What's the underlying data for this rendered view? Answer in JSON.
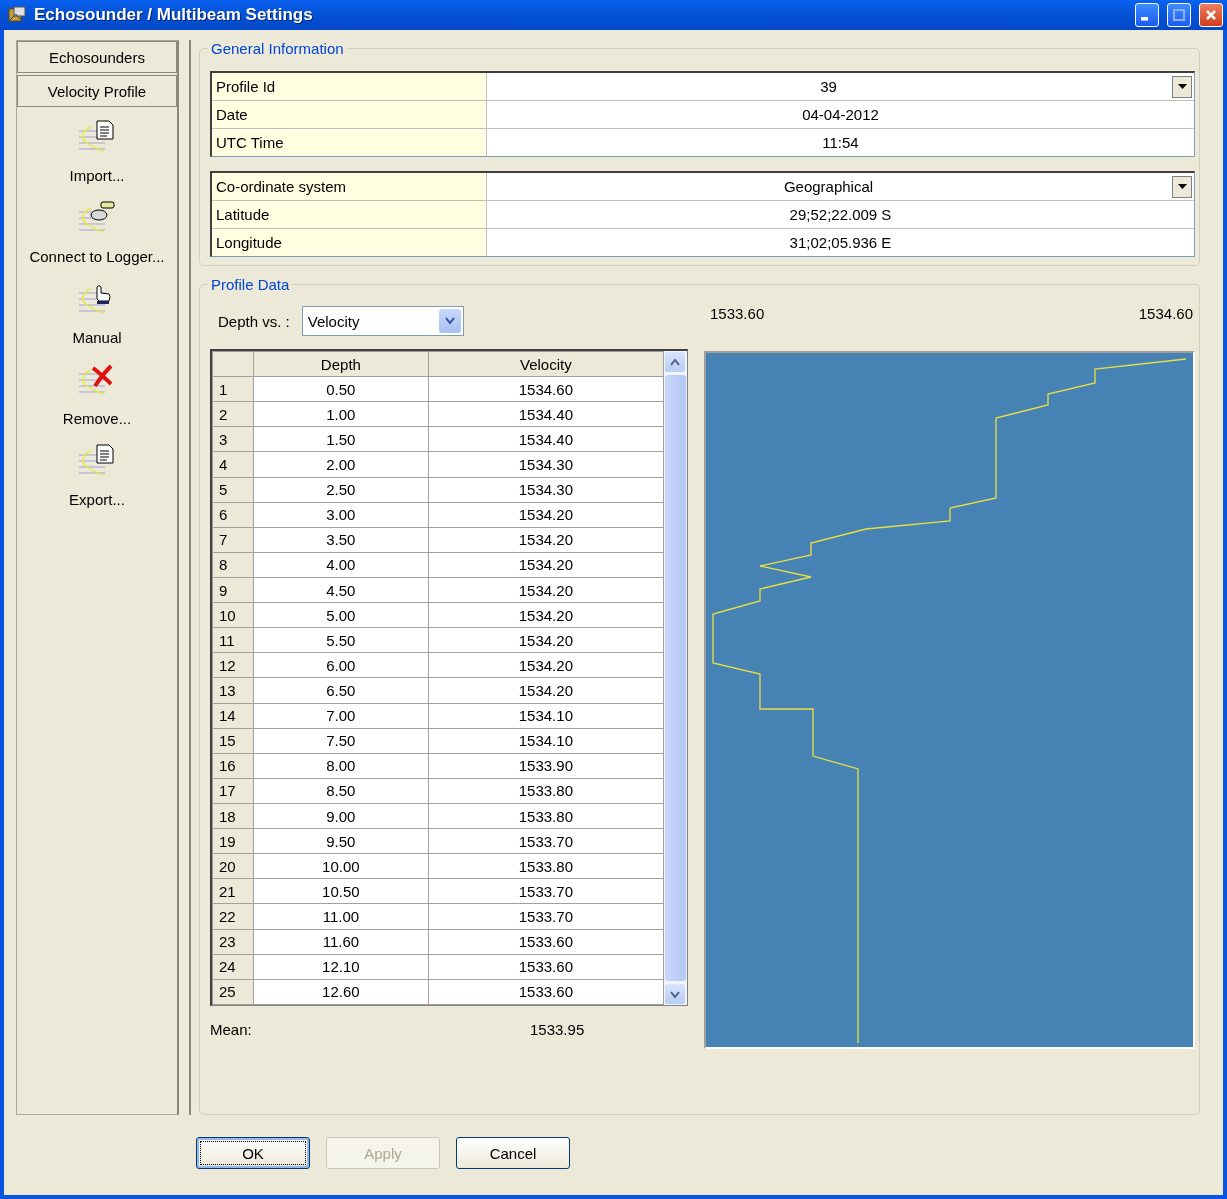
{
  "window": {
    "title": "Echosounder / Multibeam Settings"
  },
  "sidebar": {
    "sections": [
      {
        "label": "Echosounders"
      },
      {
        "label": "Velocity Profile"
      }
    ],
    "actions": [
      {
        "label": "Import...",
        "kind": "document"
      },
      {
        "label": "Connect to Logger...",
        "kind": "logger"
      },
      {
        "label": "Manual",
        "kind": "hand"
      },
      {
        "label": "Remove...",
        "kind": "remove"
      },
      {
        "label": "Export...",
        "kind": "document"
      }
    ]
  },
  "general_information": {
    "title": "General Information",
    "groups": [
      [
        {
          "label": "Profile Id",
          "value": "39",
          "kind": "dropdown"
        },
        {
          "label": "Date",
          "value": "04-04-2012",
          "kind": "text"
        },
        {
          "label": "UTC Time",
          "value": "11:54",
          "kind": "text"
        }
      ],
      [
        {
          "label": "Co-ordinate system",
          "value": "Geographical",
          "kind": "dropdown"
        },
        {
          "label": "Latitude",
          "value": "29;52;22.009 S",
          "kind": "text"
        },
        {
          "label": "Longitude",
          "value": "31;02;05.936 E",
          "kind": "text"
        }
      ]
    ]
  },
  "profile_data": {
    "title": "Profile Data",
    "depth_vs_label": "Depth vs. :",
    "depth_vs_value": "Velocity",
    "range_min": "1533.60",
    "range_max": "1534.60",
    "table": {
      "columns": [
        "",
        "Depth",
        "Velocity"
      ],
      "rows": [
        [
          "1",
          "0.50",
          "1534.60"
        ],
        [
          "2",
          "1.00",
          "1534.40"
        ],
        [
          "3",
          "1.50",
          "1534.40"
        ],
        [
          "4",
          "2.00",
          "1534.30"
        ],
        [
          "5",
          "2.50",
          "1534.30"
        ],
        [
          "6",
          "3.00",
          "1534.20"
        ],
        [
          "7",
          "3.50",
          "1534.20"
        ],
        [
          "8",
          "4.00",
          "1534.20"
        ],
        [
          "9",
          "4.50",
          "1534.20"
        ],
        [
          "10",
          "5.00",
          "1534.20"
        ],
        [
          "11",
          "5.50",
          "1534.20"
        ],
        [
          "12",
          "6.00",
          "1534.20"
        ],
        [
          "13",
          "6.50",
          "1534.20"
        ],
        [
          "14",
          "7.00",
          "1534.10"
        ],
        [
          "15",
          "7.50",
          "1534.10"
        ],
        [
          "16",
          "8.00",
          "1533.90"
        ],
        [
          "17",
          "8.50",
          "1533.80"
        ],
        [
          "18",
          "9.00",
          "1533.80"
        ],
        [
          "19",
          "9.50",
          "1533.70"
        ],
        [
          "20",
          "10.00",
          "1533.80"
        ],
        [
          "21",
          "10.50",
          "1533.70"
        ],
        [
          "22",
          "11.00",
          "1533.70"
        ],
        [
          "23",
          "11.60",
          "1533.60"
        ],
        [
          "24",
          "12.10",
          "1533.60"
        ],
        [
          "25",
          "12.60",
          "1533.60"
        ]
      ]
    },
    "mean_label": "Mean:",
    "mean_value": "1533.95"
  },
  "buttons": [
    {
      "label": "OK",
      "disabled": false,
      "default": true
    },
    {
      "label": "Apply",
      "disabled": true,
      "default": false
    },
    {
      "label": "Cancel",
      "disabled": false,
      "default": false
    }
  ]
}
